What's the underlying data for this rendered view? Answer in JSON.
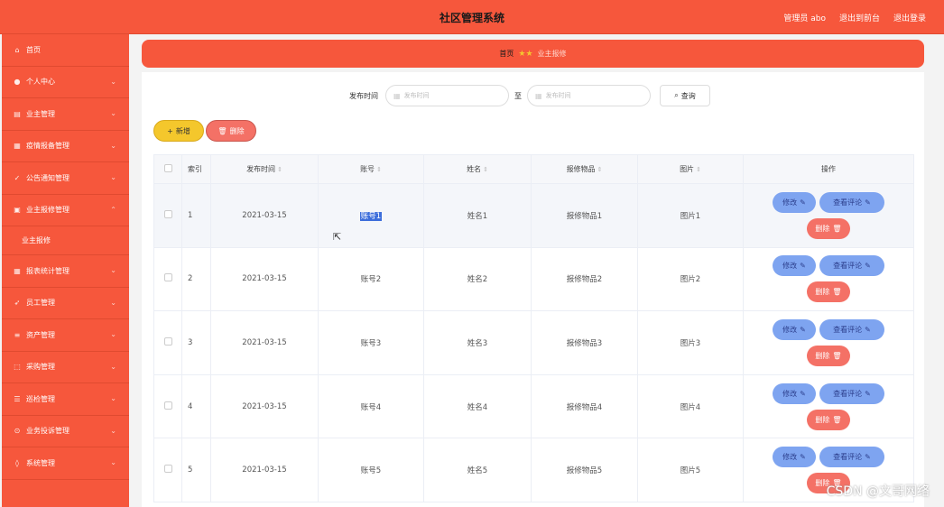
{
  "header": {
    "title": "社区管理系统",
    "admin_label": "管理员 abo",
    "exit_front": "退出到前台",
    "logout": "退出登录"
  },
  "sidebar": {
    "items": [
      {
        "label": "首页",
        "icon": "home-icon",
        "glyph": "⌂"
      },
      {
        "label": "个人中心",
        "icon": "user-icon",
        "glyph": "👤"
      },
      {
        "label": "业主管理",
        "icon": "user-group-icon",
        "glyph": "▤"
      },
      {
        "label": "疫情报备管理",
        "icon": "grid-icon",
        "glyph": "▦"
      },
      {
        "label": "公告通知管理",
        "icon": "check-icon",
        "glyph": "✓"
      },
      {
        "label": "业主报修管理",
        "icon": "tools-icon",
        "glyph": "▣"
      },
      {
        "label": "报表统计管理",
        "icon": "chart-icon",
        "glyph": "▦"
      },
      {
        "label": "员工管理",
        "icon": "send-icon",
        "glyph": "➶"
      },
      {
        "label": "资产管理",
        "icon": "list-icon",
        "glyph": "≡"
      },
      {
        "label": "采购管理",
        "icon": "bag-icon",
        "glyph": "⬚"
      },
      {
        "label": "巡检管理",
        "icon": "menu-icon",
        "glyph": "☰"
      },
      {
        "label": "业务投诉管理",
        "icon": "alert-icon",
        "glyph": "⊙"
      },
      {
        "label": "系统管理",
        "icon": "pin-icon",
        "glyph": "◊"
      }
    ],
    "active_sub": "业主报修"
  },
  "breadcrumb": {
    "home": "首页",
    "current": "业主报修"
  },
  "search": {
    "label": "发布时间",
    "start_placeholder": "发布时间",
    "to": "至",
    "end_placeholder": "发布时间",
    "button": "查询"
  },
  "toolbar": {
    "add": "新增",
    "delete": "删除"
  },
  "table": {
    "headers": [
      "索引",
      "发布时间",
      "账号",
      "姓名",
      "报修物品",
      "图片",
      "操作"
    ],
    "rows": [
      {
        "idx": "1",
        "date": "2021-03-15",
        "account": "账号1",
        "name": "姓名1",
        "item": "报修物品1",
        "image": "图片1"
      },
      {
        "idx": "2",
        "date": "2021-03-15",
        "account": "账号2",
        "name": "姓名2",
        "item": "报修物品2",
        "image": "图片2"
      },
      {
        "idx": "3",
        "date": "2021-03-15",
        "account": "账号3",
        "name": "姓名3",
        "item": "报修物品3",
        "image": "图片3"
      },
      {
        "idx": "4",
        "date": "2021-03-15",
        "account": "账号4",
        "name": "姓名4",
        "item": "报修物品4",
        "image": "图片4"
      },
      {
        "idx": "5",
        "date": "2021-03-15",
        "account": "账号5",
        "name": "姓名5",
        "item": "报修物品5",
        "image": "图片5"
      }
    ],
    "op_edit": "修改",
    "op_view": "查看评论",
    "op_delete": "删除"
  },
  "watermark": "CSDN @文哥网络",
  "colors": {
    "primary": "#f6573c",
    "add_button": "#f4c72c",
    "danger": "#f47166",
    "op_button": "#7ea4f0"
  }
}
